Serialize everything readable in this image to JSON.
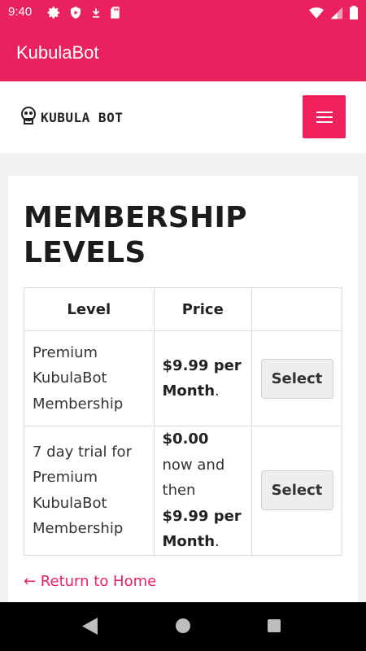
{
  "status_bar": {
    "time": "9:40",
    "left_icons": [
      "settings-icon",
      "shield-icon",
      "download-icon",
      "sd-card-icon"
    ],
    "right_icons": [
      "wifi-icon",
      "signal-icon",
      "battery-icon"
    ]
  },
  "app_bar": {
    "title": "KubulaBot"
  },
  "site_header": {
    "logo_text": "KUBULA BOT",
    "menu_icon": "hamburger-icon"
  },
  "main": {
    "heading": "MEMBERSHIP LEVELS",
    "table": {
      "headers": [
        "Level",
        "Price",
        ""
      ],
      "rows": [
        {
          "level": "Premium KubulaBot Membership",
          "price_bold": "$9.99 per Month",
          "price_suffix": ".",
          "action": "Select"
        },
        {
          "level": "7 day trial for Premium KubulaBot Membership",
          "price_bold_1": "$0.00",
          "price_mid": " now and then ",
          "price_bold_2": "$9.99 per Month",
          "price_suffix": ".",
          "action": "Select"
        }
      ]
    },
    "return_link": "← Return to Home"
  },
  "nav_bar": {
    "icons": [
      "back-icon",
      "home-icon",
      "recents-icon"
    ]
  },
  "colors": {
    "accent": "#e9215f",
    "menu_button": "#f0205c"
  }
}
